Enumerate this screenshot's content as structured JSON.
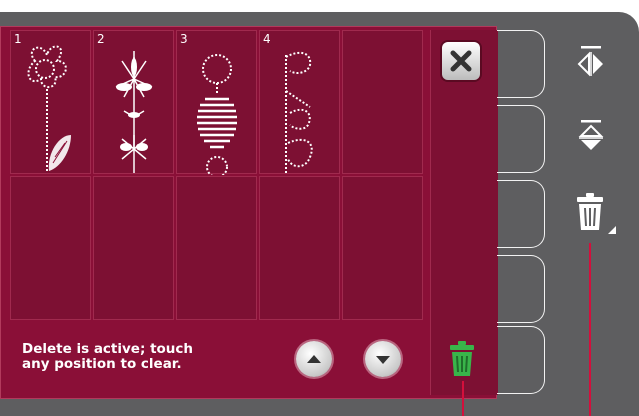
{
  "grid": {
    "cells": [
      {
        "number": "1"
      },
      {
        "number": "2"
      },
      {
        "number": "3"
      },
      {
        "number": "4"
      },
      {
        "number": ""
      },
      {
        "number": ""
      },
      {
        "number": ""
      },
      {
        "number": ""
      },
      {
        "number": ""
      },
      {
        "number": ""
      }
    ]
  },
  "info": {
    "message": "Delete is active; touch\nany position to clear."
  },
  "icons": {
    "close": "close-icon",
    "scroll_up": "arrow-up-icon",
    "scroll_down": "arrow-down-icon",
    "delete_active": "trash-icon",
    "mirror_side_to_side": "mirror-side-to-side-icon",
    "mirror_end_to_end": "mirror-end-to-end-icon",
    "delete": "trash-icon"
  },
  "colors": {
    "panel": "#8a0f37",
    "background": "#5e5e60",
    "active_delete": "#39b54a",
    "pointer_line": "#d40f3c"
  }
}
